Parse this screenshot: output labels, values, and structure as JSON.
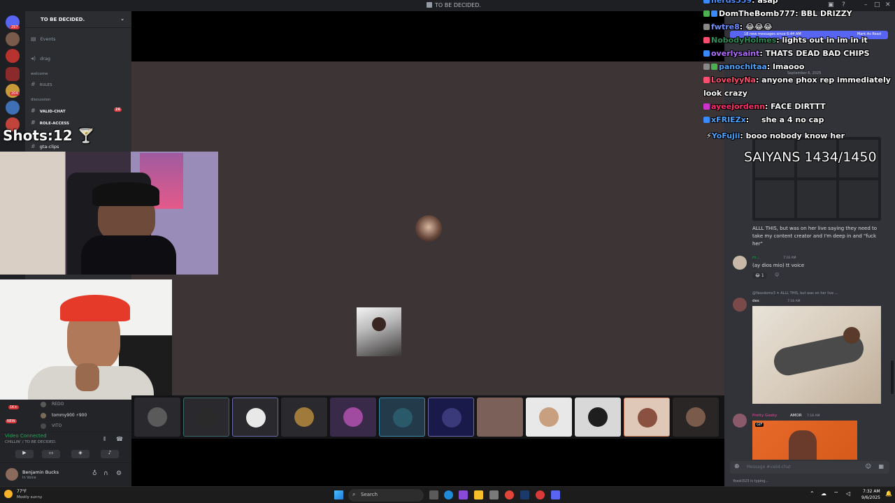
{
  "window": {
    "title": "TO BE DECIDED."
  },
  "server_header": "TO BE DECIDED.",
  "server_badges": [
    "297",
    "1K+",
    "204",
    "16",
    "42"
  ],
  "channels": {
    "events": "Events",
    "drag": "drag",
    "cat_welcome": "welcome",
    "rules": "RULES",
    "cat_discussion": "discussion",
    "valid_chat": "VALID-CHAT",
    "valid_chat_badge": "26",
    "role_access": "ROLE-ACCESS",
    "gta_clips": "gta-clips"
  },
  "overlay": {
    "shots": "Shots:12",
    "saiyans": "SAIYANS 1434/1450"
  },
  "chat": [
    {
      "user": "nerds559",
      "text": "asap",
      "color": "#3b8cff"
    },
    {
      "user": "DomTheBomb777",
      "text": "BBL DRIZZY",
      "color": "#ffffff"
    },
    {
      "user": "fwtre8",
      "text": "😂😂😂",
      "color": "#6a8cff"
    },
    {
      "user": "NobodyHolmes",
      "text": "lights out in im in it",
      "color": "#2e8b57"
    },
    {
      "user": "overlysaint",
      "text": "THATS DEAD BAD CHIPS",
      "color": "#b06cff"
    },
    {
      "user": "panochitaa",
      "text": "lmaooo",
      "color": "#4aa3ff"
    },
    {
      "user": "LovelyyNa",
      "text": "anyone phox rep immediately look crazy",
      "color": "#ff4d6d"
    },
    {
      "user": "ayeejordenn",
      "text": "FACE DIRTTT",
      "color": "#ff2e6a"
    },
    {
      "user": "xFRIEZx",
      "text": "she a 4 no cap",
      "color": "#4aa3ff"
    },
    {
      "user": "YoFujii",
      "text": "booo nobody know her",
      "color": "#4aa3ff"
    }
  ],
  "discord_right": {
    "new_messages": "18 new messages since 6:44 AM",
    "mark_as_read": "Mark As Read",
    "date_divider": "September 6, 2025",
    "quote_text": "ALLL THIS, but was on her live saying they need to take my content creator and I'm deep in and \"fuck her\"",
    "msg1_name": "m...",
    "msg1_time": "7:16 AM",
    "msg1_text": "(ay dios mio) tt voice",
    "msg1_reaction": "1",
    "msg2_reply": "@Yassdomx3 ✦ ALLL THIS, but was on her live ...",
    "msg2_name": "des",
    "msg2_time": "7:16 AM",
    "msg3_name": "Pretty Geeky",
    "msg3_tag": "AMOR",
    "msg3_time": "7:16 AM",
    "gif_label": "GIF",
    "input_placeholder": "Message #valid-chat",
    "typing": "Yoesli323 is typing..."
  },
  "voice": {
    "user_redo": "REDO",
    "user_tommy": "tommy900",
    "user_tommy_extra": "900",
    "user_vito": "VITO",
    "badge_new": "NEW",
    "badge_1k": "1K+",
    "connected": "Video Connected",
    "channel_path": "CHILLIN' / TO BE DECIDED."
  },
  "user": {
    "name": "Benjamin Bucks",
    "status": "In Voice"
  },
  "taskbar": {
    "search": "Search",
    "weather_temp": "77°F",
    "weather_desc": "Mostly sunny",
    "time": "7:32 AM",
    "date": "9/6/2025"
  },
  "colors": {
    "discord_dark": "#1e1f22",
    "panel": "#2b2d31",
    "chat_bg": "#313338",
    "accent_red": "#da373c",
    "voice_green": "#23a55a"
  }
}
